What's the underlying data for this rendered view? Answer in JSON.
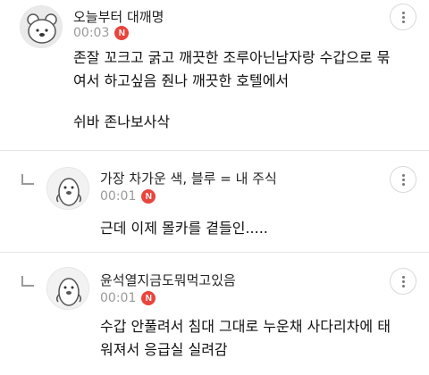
{
  "comments": [
    {
      "nickname": "오늘부터 대깨명",
      "time": "00:03",
      "badge": "N",
      "lines": [
        "존잘 꼬크고 굵고 깨끗한 조루아닌남자랑 수갑으로 묶",
        "여서 하고싶음 줜나 깨끗한 호텔에서",
        "",
        "쉬바 존나보사삭"
      ],
      "is_reply": false
    },
    {
      "nickname": "가장 차가운 색, 블루 = 내 주식",
      "time": "00:01",
      "badge": "N",
      "lines": [
        "근데 이제 몰카를 곁들인....."
      ],
      "is_reply": true
    },
    {
      "nickname": "윤석열지금도뭐먹고있음",
      "time": "00:01",
      "badge": "N",
      "lines": [
        "수갑 안풀려서 침대 그대로 누운채 사다리차에 태",
        "워져서 응급실 실려감"
      ],
      "is_reply": true
    }
  ],
  "icons": {
    "more": "more-vertical-icon",
    "reply": "reply-arrow-icon",
    "avatar_bear": "bear-avatar-icon",
    "avatar_penguin": "penguin-avatar-icon"
  },
  "colors": {
    "badge": "#e8453c",
    "meta": "#9a9a9a",
    "divider": "#e5e5e5"
  }
}
